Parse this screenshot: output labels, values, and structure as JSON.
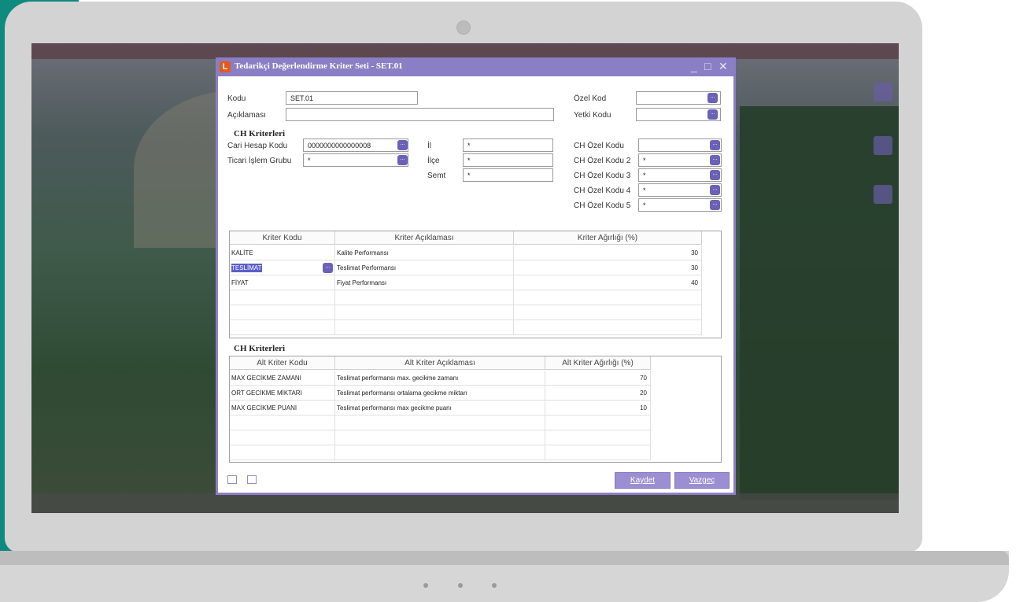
{
  "window": {
    "title": "Tedarikçi Değerlendirme Kriter Seti - SET.01",
    "controls": [
      "_",
      "□",
      "✕"
    ]
  },
  "form": {
    "kodu_label": "Kodu",
    "kodu_value": "SET.01",
    "aciklama_label": "Açıklaması",
    "aciklama_value": "",
    "ozel_kod_label": "Özel Kod",
    "ozel_kod_value": "",
    "yetki_kodu_label": "Yetki Kodu",
    "yetki_kodu_value": ""
  },
  "ch_criteria": {
    "title": "CH Kriterleri",
    "cari_label": "Cari Hesap Kodu",
    "cari_value": "0000000000000008",
    "ticari_label": "Ticari İşlem Grubu",
    "ticari_value": "*",
    "il_label": "İl",
    "il_value": "*",
    "ilce_label": "İlçe",
    "ilce_value": "*",
    "semt_label": "Semt",
    "semt_value": "*",
    "ozel_kodlar": [
      {
        "label": "CH Özel Kodu",
        "value": ""
      },
      {
        "label": "CH Özel Kodu 2",
        "value": "*"
      },
      {
        "label": "CH Özel Kodu 3",
        "value": "*"
      },
      {
        "label": "CH Özel Kodu 4",
        "value": "*"
      },
      {
        "label": "CH Özel Kodu 5",
        "value": "*"
      }
    ]
  },
  "criteria_table": {
    "headers": [
      "Kriter Kodu",
      "Kriter Açıklaması",
      "Kriter Ağırlığı (%)"
    ],
    "rows": [
      [
        "KALİTE",
        "Kalite Performansı",
        "30"
      ],
      [
        "TESLİMAT",
        "Teslimat Performansı",
        "30"
      ],
      [
        "FİYAT",
        "Fiyat Performansı",
        "40"
      ]
    ],
    "selected_row": 1
  },
  "sub_criteria": {
    "title": "CH Kriterleri",
    "headers": [
      "Alt Kriter Kodu",
      "Alt Kriter Açıklaması",
      "Alt Kriter Ağırlığı (%)"
    ],
    "rows": [
      [
        "MAX GECİKME ZAMANI",
        "Teslimat performansı max. gecikme zamanı",
        "70"
      ],
      [
        "ORT GECİKME MİKTARI",
        "Teslimat performansı ortalama gecikme miktarı",
        "20"
      ],
      [
        "MAX GECİKME PUANI",
        "Teslimat performansı max gecikme puanı",
        "10"
      ]
    ]
  },
  "buttons": {
    "save": "Kaydet",
    "cancel": "Vazgeç"
  },
  "colors": {
    "accent": "#8a7ec4",
    "button": "#9b8fd1",
    "lookup_button": "#6b62b8",
    "selection": "#5a5ec9"
  }
}
